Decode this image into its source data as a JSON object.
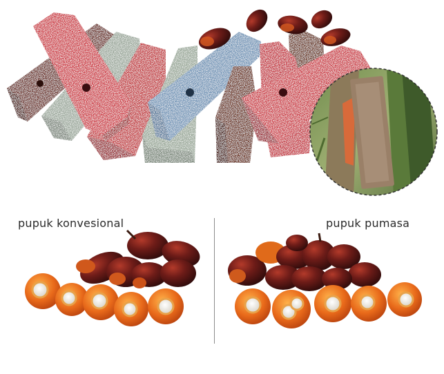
{
  "captions": {
    "left": "pupuk konvesional",
    "right": "pupuk pumasa"
  },
  "colors": {
    "red": "#c8323c",
    "maroon": "#6b2a22",
    "sage": "#9aa79a",
    "blue": "#6e93b6",
    "brown": "#6a2d1f",
    "fruit_dark": "#4a1414",
    "fruit_orange": "#e06a1a",
    "kernel": "#f2f2f2"
  }
}
